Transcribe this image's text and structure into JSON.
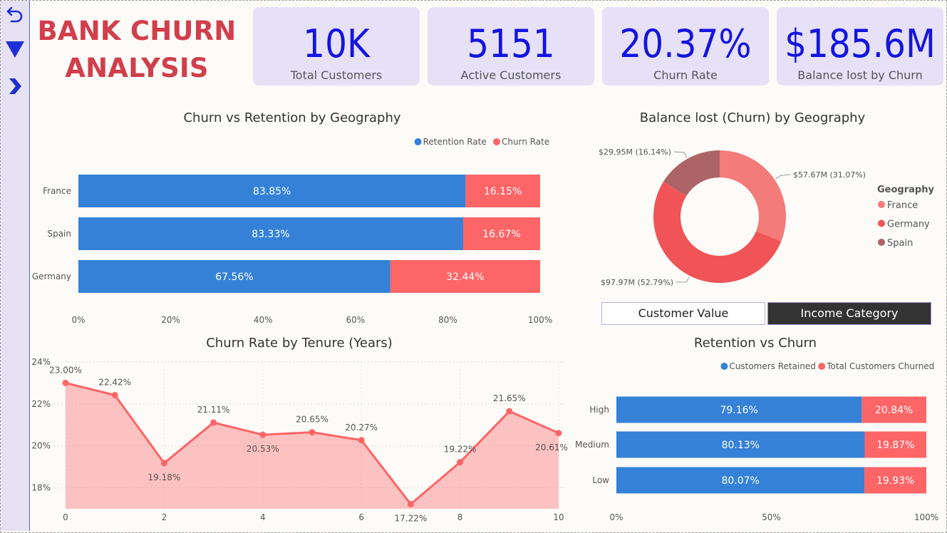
{
  "title": {
    "line1": "BANK CHURN",
    "line2": "ANALYSIS"
  },
  "nav": [
    {
      "name": "back-arrow-icon"
    },
    {
      "name": "filter-icon"
    },
    {
      "name": "chevron-right-icon"
    }
  ],
  "kpis": [
    {
      "value": "10K",
      "label": "Total Customers"
    },
    {
      "value": "5151",
      "label": "Active Customers"
    },
    {
      "value": "20.37%",
      "label": "Churn Rate"
    },
    {
      "value": "$185.6M",
      "label": "Balance lost by Churn"
    }
  ],
  "toggles": {
    "customer_value": "Customer Value",
    "income_category": "Income Category"
  },
  "colors": {
    "retention": "#3581d8",
    "churn": "#fd6567",
    "title_red": "#d13f4c",
    "kpi_blue": "#1414e0"
  },
  "chart_data": [
    {
      "type": "bar",
      "orientation": "horizontal",
      "stacked": "100%",
      "title": "Churn vs Retention by Geography",
      "categories": [
        "France",
        "Spain",
        "Germany"
      ],
      "series": [
        {
          "name": "Retention Rate",
          "values": [
            83.85,
            83.33,
            67.56
          ],
          "labels": [
            "83.85%",
            "83.33%",
            "67.56%"
          ]
        },
        {
          "name": "Churn Rate",
          "values": [
            16.15,
            16.67,
            32.44
          ],
          "labels": [
            "16.15%",
            "16.67%",
            "32.44%"
          ]
        }
      ],
      "xlim": [
        0,
        100
      ],
      "x_ticks": [
        "0%",
        "20%",
        "40%",
        "60%",
        "80%",
        "100%"
      ],
      "legend": "top-right",
      "grid": false
    },
    {
      "type": "pie",
      "donut": true,
      "title": "Balance lost (Churn) by Geography",
      "legend_title": "Geography",
      "legend": "right",
      "slices": [
        {
          "name": "France",
          "value": 57.67,
          "label": "$57.67M (31.07%)",
          "color": "#f37b7a"
        },
        {
          "name": "Germany",
          "value": 97.97,
          "label": "$97.97M (52.79%)",
          "color": "#f05457"
        },
        {
          "name": "Spain",
          "value": 29.95,
          "label": "$29.95M (16.14%)",
          "color": "#ad6467"
        }
      ]
    },
    {
      "type": "area",
      "title": "Churn Rate by Tenure (Years)",
      "x": [
        0,
        1,
        2,
        3,
        4,
        5,
        6,
        7,
        8,
        9,
        10
      ],
      "values": [
        23.0,
        22.42,
        19.18,
        21.11,
        20.53,
        20.65,
        20.27,
        17.22,
        19.22,
        21.65,
        20.61
      ],
      "labels": [
        "23.00%",
        "22.42%",
        "19.18%",
        "21.11%",
        "20.53%",
        "20.65%",
        "20.27%",
        "17.22%",
        "19.22%",
        "21.65%",
        "20.61%"
      ],
      "x_ticks": [
        "0",
        "2",
        "4",
        "6",
        "8",
        "10"
      ],
      "y_ticks": [
        "18%",
        "20%",
        "22%",
        "24%"
      ],
      "ylim": [
        17,
        24
      ],
      "grid": true
    },
    {
      "type": "bar",
      "orientation": "horizontal",
      "stacked": "100%",
      "title": "Retention vs Churn",
      "categories": [
        "High",
        "Medium",
        "Low"
      ],
      "series": [
        {
          "name": "Customers Retained",
          "values": [
            79.16,
            80.13,
            80.07
          ],
          "labels": [
            "79.16%",
            "80.13%",
            "80.07%"
          ]
        },
        {
          "name": "Total Customers Churned",
          "values": [
            20.84,
            19.87,
            19.93
          ],
          "labels": [
            "20.84%",
            "19.87%",
            "19.93%"
          ]
        }
      ],
      "xlim": [
        0,
        100
      ],
      "x_ticks": [
        "0%",
        "50%",
        "100%"
      ],
      "legend": "top-right",
      "grid": false
    }
  ]
}
